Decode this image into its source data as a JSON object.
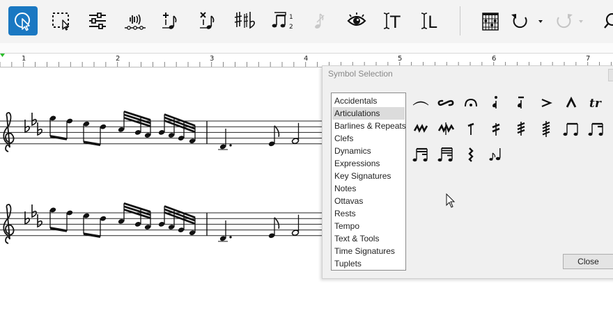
{
  "toolbar": {
    "buttons": [
      {
        "name": "select-tool",
        "icon": "pointer-icon",
        "active": true
      },
      {
        "name": "marquee-tool",
        "icon": "marquee-select-icon"
      },
      {
        "name": "mixer",
        "icon": "sliders-icon"
      },
      {
        "name": "playback",
        "icon": "speaker-icon"
      },
      {
        "name": "add-note",
        "icon": "note-add-icon"
      },
      {
        "name": "delete-note",
        "icon": "note-delete-icon"
      },
      {
        "name": "accidentals",
        "icon": "sharp-flat-icon"
      },
      {
        "name": "tuplet",
        "icon": "tuplet-icon",
        "label": "1 2"
      },
      {
        "name": "grace-note",
        "icon": "grace-note-icon",
        "disabled": true
      },
      {
        "name": "view",
        "icon": "eye-icon"
      },
      {
        "name": "text",
        "icon": "text-cursor-icon",
        "label": "T"
      },
      {
        "name": "lyric",
        "icon": "lyric-cursor-icon",
        "label": "L"
      },
      {
        "name": "chord-diagram",
        "icon": "chord-grid-icon"
      },
      {
        "name": "undo",
        "icon": "undo-icon"
      },
      {
        "name": "redo",
        "icon": "redo-icon",
        "disabled": true
      },
      {
        "name": "search",
        "icon": "search-icon"
      }
    ],
    "tuplet_label": "1 2",
    "text_label": "T",
    "lyric_label": "L",
    "accent_color": "#1a78c2"
  },
  "ruler": {
    "marks": [
      "1",
      "2",
      "3",
      "4",
      "5",
      "6",
      "7"
    ]
  },
  "score": {
    "clef": "treble",
    "key_signature": "3 flats"
  },
  "dialog": {
    "title": "Symbol Selection",
    "categories": [
      "Accidentals",
      "Articulations",
      "Barlines & Repeats",
      "Clefs",
      "Dynamics",
      "Expressions",
      "Key Signatures",
      "Notes",
      "Ottavas",
      "Rests",
      "Tempo",
      "Text & Tools",
      "Time Signatures",
      "Tuplets"
    ],
    "selected_category": "Articulations",
    "symbols": [
      "slur-icon",
      "turn-icon",
      "fermata-icon",
      "staccato-tenuto-icon",
      "tenuto-staccato-icon",
      "accent-icon",
      "marcato-icon",
      "trill-icon",
      "short-trill-icon",
      "mordent-icon",
      "tenuto-stroke-icon",
      "tremolo-2-icon",
      "tremolo-3-icon",
      "tremolo-4-icon",
      "beamed-eighths-icon",
      "beamed-sixteenths-icon",
      "beamed-32nds-icon",
      "beamed-64ths-icon",
      "tremolo-z-icon",
      "grace-note-icon"
    ],
    "trill_label": "tr",
    "close_label": "Close"
  }
}
